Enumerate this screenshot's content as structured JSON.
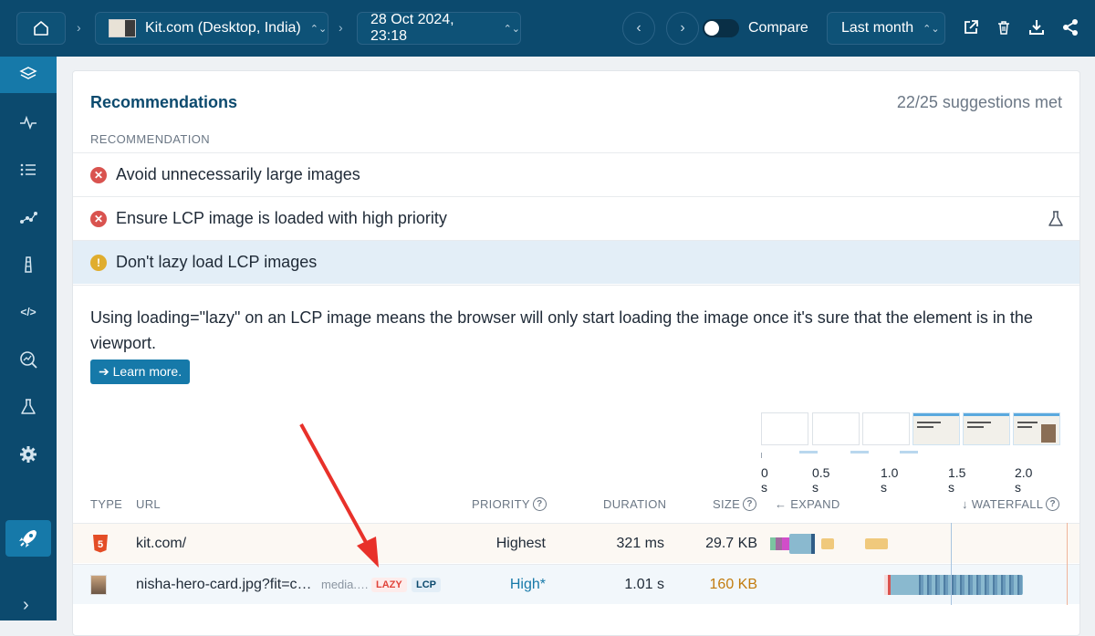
{
  "topbar": {
    "home_icon": "home-icon",
    "site_label": "Kit.com (Desktop, India)",
    "date_label": "28 Oct 2024, 23:18",
    "compare_label": "Compare",
    "compare_on": false,
    "range_label": "Last month",
    "action_icons": [
      "external-link-icon",
      "trash-icon",
      "download-icon",
      "share-icon"
    ]
  },
  "sidebar": {
    "items": [
      {
        "icon": "layers-icon",
        "active": true
      },
      {
        "icon": "pulse-icon",
        "active": false
      },
      {
        "icon": "list-icon",
        "active": false
      },
      {
        "icon": "scatter-icon",
        "active": false
      },
      {
        "icon": "tower-icon",
        "active": false
      },
      {
        "icon": "code-icon",
        "active": false
      },
      {
        "icon": "search-chart-icon",
        "active": false
      },
      {
        "icon": "flask-icon",
        "active": false
      },
      {
        "icon": "gear-icon",
        "active": false
      }
    ],
    "rocket_icon": "rocket-icon",
    "expand_label": "›"
  },
  "card": {
    "title": "Recommendations",
    "meta": "22/25 suggestions met",
    "column_label": "RECOMMENDATION",
    "recommendations": [
      {
        "label": "Avoid unnecessarily large images",
        "status": "fail"
      },
      {
        "label": "Ensure LCP image is loaded with high priority",
        "status": "fail",
        "experiment": true
      },
      {
        "label": "Don't lazy load LCP images",
        "status": "warn",
        "selected": true
      }
    ],
    "description": "Using loading=\"lazy\" on an LCP image means the browser will only start loading the image once it's sure that the element is in the viewport.",
    "learn_more": "➔ Learn more.",
    "timeline_ticks": [
      "0 s",
      "0.5 s",
      "1.0 s",
      "1.5 s",
      "2.0 s"
    ],
    "table": {
      "headers": {
        "type": "TYPE",
        "url": "URL",
        "priority": "PRIORITY",
        "duration": "DURATION",
        "size": "SIZE",
        "expand": "← EXPAND",
        "waterfall": "↓ WATERFALL"
      },
      "rows": [
        {
          "type_icon": "html5-icon",
          "url": "kit.com/",
          "url_extra": "",
          "tags": [],
          "priority": "Highest",
          "duration": "321 ms",
          "size": "29.7 KB",
          "size_color": "#1f2a37"
        },
        {
          "type_icon": "image-thumb-icon",
          "url": "nisha-hero-card.jpg?fit=c…",
          "url_extra": "media.…",
          "tags": [
            "LAZY",
            "LCP"
          ],
          "priority": "High*",
          "duration": "1.01 s",
          "size": "160 KB",
          "size_color": "#c27c0e"
        }
      ]
    }
  },
  "colors": {
    "nav_bg": "#0c4a6e",
    "accent": "#1679a9",
    "fail": "#d9534f",
    "warn": "#e0ad2e",
    "arrow": "#e8312a"
  }
}
